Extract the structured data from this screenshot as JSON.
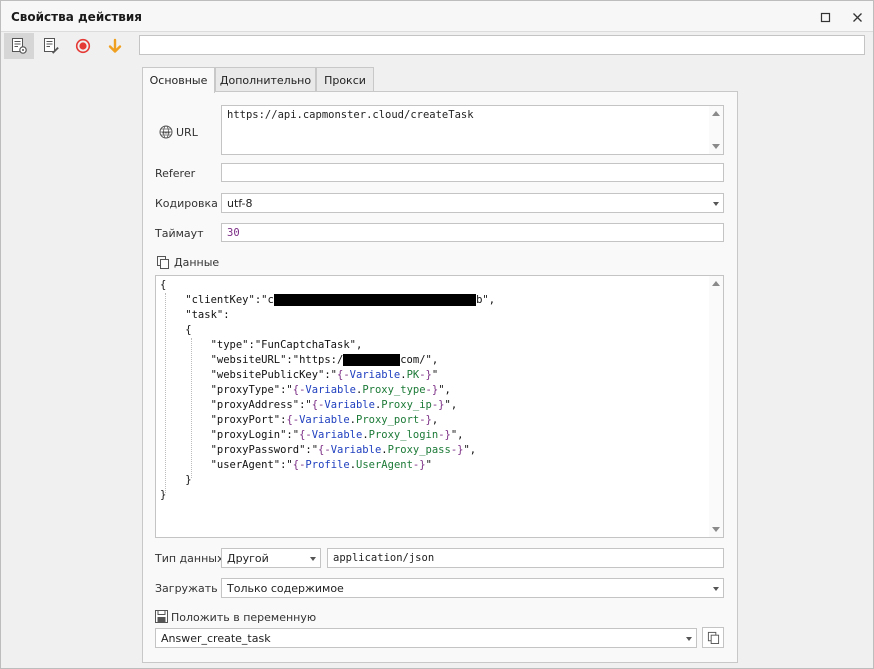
{
  "window": {
    "title": "Свойства действия"
  },
  "tabs": [
    "Основные",
    "Дополнительно",
    "Прокси"
  ],
  "url": {
    "label": "URL",
    "value": "https://api.capmonster.cloud/createTask"
  },
  "referer": {
    "label": "Referer",
    "value": ""
  },
  "encoding": {
    "label": "Кодировка",
    "value": "utf-8"
  },
  "timeout": {
    "label": "Таймаут",
    "value": "30"
  },
  "data_label": "Данные",
  "data_type": {
    "label": "Тип данных",
    "value": "Другой",
    "mime": "application/json"
  },
  "load": {
    "label": "Загружать",
    "value": "Только содержимое"
  },
  "save_var": {
    "label": "Положить в переменную",
    "value": "Answer_create_task"
  },
  "colors": {
    "variable_brace": "#7a2c84",
    "variable_name": "#1f3fbf",
    "variable_path": "#1c7a37"
  },
  "icons": [
    "properties-icon",
    "notes-icon",
    "record-icon",
    "arrow-down-icon",
    "web-icon",
    "copy-icon",
    "save-icon",
    "maximize-icon",
    "close-icon"
  ],
  "code_lines": [
    "{",
    "    \"clientKey\":\"c",
    "    \"task\":",
    "    {",
    "        \"type\":\"FunCaptchaTask\",",
    "        \"websiteURL\":\"https:/",
    "        \"websitePublicKey\":\"",
    "        \"proxyType\":\"",
    "        \"proxyAddress\":\"",
    "        \"proxyPort\":",
    "        \"proxyLogin\":\"",
    "        \"proxyPassword\":\"",
    "        \"userAgent\":\"",
    "    }",
    "}"
  ],
  "code_tail": {
    "client_key_end": "b\",",
    "website_url_end": "com/\",",
    "pk": [
      "{-",
      "Variable",
      ".",
      "PK",
      "-}",
      "\""
    ],
    "proxy_type": [
      "{-",
      "Variable",
      ".",
      "Proxy_type",
      "-}",
      "\","
    ],
    "proxy_address": [
      "{-",
      "Variable",
      ".",
      "Proxy_ip",
      "-}",
      "\","
    ],
    "proxy_port": [
      "{-",
      "Variable",
      ".",
      "Proxy_port",
      "-}",
      ","
    ],
    "proxy_login": [
      "{-",
      "Variable",
      ".",
      "Proxy_login",
      "-}",
      "\","
    ],
    "proxy_password": [
      "{-",
      "Variable",
      ".",
      "Proxy_pass",
      "-}",
      "\","
    ],
    "user_agent": [
      "{-",
      "Profile",
      ".",
      "UserAgent",
      "-}",
      "\""
    ]
  }
}
